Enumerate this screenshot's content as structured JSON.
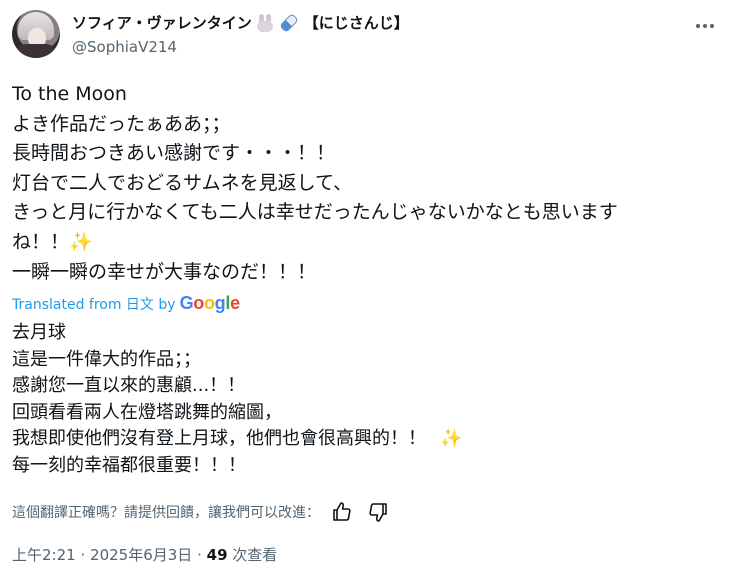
{
  "header": {
    "display_name": "ソフィア・ヴァレンタイン",
    "name_suffix": "【にじさんじ】",
    "handle": "@SophiaV214",
    "icons": [
      "rabbit-emoji",
      "capsule-emoji",
      "more-icon"
    ]
  },
  "post": {
    "original_lines": [
      "To the Moon",
      "よき作品だったぁああ；；",
      "長時間おつきあい感謝です・・・！！",
      "灯台で二人でおどるサムネを見返して、",
      "きっと月に行かなくても二人は幸せだったんじゃないかなとも思います",
      "ね！！",
      "一瞬一瞬の幸せが大事なのだ！！！"
    ],
    "sparkle": "✨",
    "translated_from": "Translated from 日文 by",
    "google_letters": [
      "G",
      "o",
      "o",
      "g",
      "l",
      "e"
    ],
    "translation_lines": [
      "去月球",
      "這是一件偉大的作品；；",
      "感謝您一直以來的惠顧...！！",
      "回頭看看兩人在燈塔跳舞的縮圖，",
      "我想即使他們沒有登上月球，他們也會很高興的！！",
      "每一刻的幸福都很重要！！！"
    ]
  },
  "feedback": {
    "prompt": "這個翻譯正確嗎？請提供回饋，讓我們可以改進：",
    "icons": [
      "thumbs-up-icon",
      "thumbs-down-icon"
    ]
  },
  "meta": {
    "time": "上午2:21",
    "date": "2025年6月3日",
    "separator": "·",
    "views_count": "49",
    "views_label": "次查看"
  },
  "colors": {
    "text": "#0f1419",
    "secondary": "#536471",
    "link": "#1d9bf0"
  }
}
